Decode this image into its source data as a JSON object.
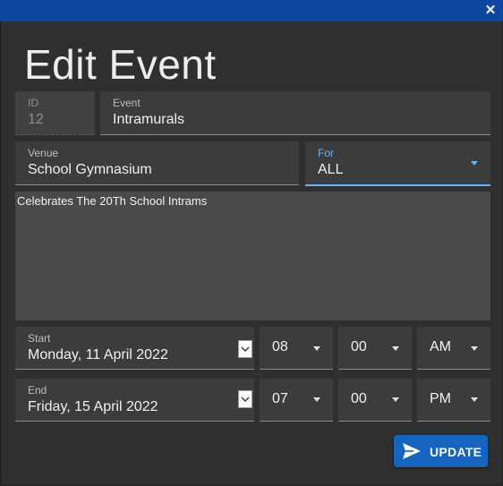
{
  "window": {
    "close_glyph": "✕"
  },
  "title": "Edit Event",
  "fields": {
    "id": {
      "label": "ID",
      "value": "12"
    },
    "event": {
      "label": "Event",
      "value": "Intramurals"
    },
    "venue": {
      "label": "Venue",
      "value": "School Gymnasium"
    },
    "for": {
      "label": "For",
      "value": "ALL"
    }
  },
  "description": "Celebrates The 20Th School Intrams",
  "start": {
    "label": "Start",
    "date": "Monday, 11 April 2022",
    "hour": "08",
    "minute": "00",
    "ampm": "AM"
  },
  "end": {
    "label": "End",
    "date": "Friday, 15 April 2022",
    "hour": "07",
    "minute": "00",
    "ampm": "PM"
  },
  "update_button": {
    "label": "UPDATE",
    "icon": "send-icon"
  },
  "colors": {
    "titlebar": "#0d47a1",
    "accent": "#64b5f6",
    "button": "#1565c0",
    "background": "#2f2f2f"
  }
}
